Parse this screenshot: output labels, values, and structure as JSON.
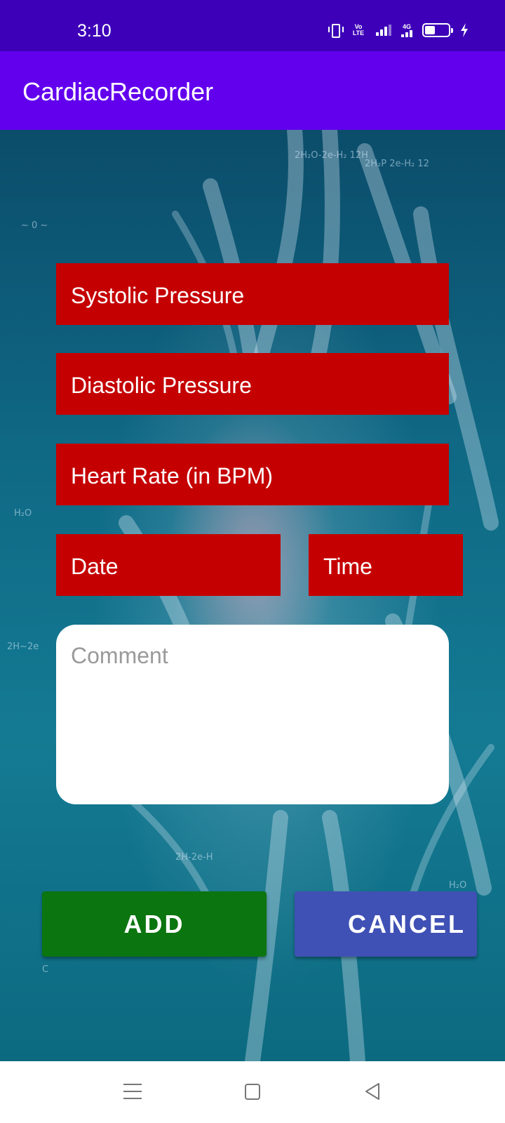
{
  "status_bar": {
    "time": "3:10",
    "icons": [
      "vibrate-icon",
      "volte-icon",
      "signal-icon",
      "4g-signal-icon",
      "battery-icon",
      "charging-bolt-icon"
    ],
    "volte_label": "Vo LTE",
    "network_label": "4G"
  },
  "app_bar": {
    "title": "CardiacRecorder"
  },
  "form": {
    "systolic_placeholder": "Systolic Pressure",
    "diastolic_placeholder": "Diastolic Pressure",
    "heart_rate_placeholder": "Heart Rate (in BPM)",
    "date_placeholder": "Date",
    "time_placeholder": "Time",
    "comment_placeholder": "Comment"
  },
  "buttons": {
    "add_label": "ADD",
    "cancel_label": "CANCEL"
  },
  "nav_bar": {
    "icons": [
      "menu-icon",
      "home-icon",
      "back-icon"
    ]
  },
  "colors": {
    "status_bar": "#3d00b8",
    "app_bar": "#6200ee",
    "field_background": "#c50000",
    "add_button": "#0b7510",
    "cancel_button": "#3f51b5"
  }
}
